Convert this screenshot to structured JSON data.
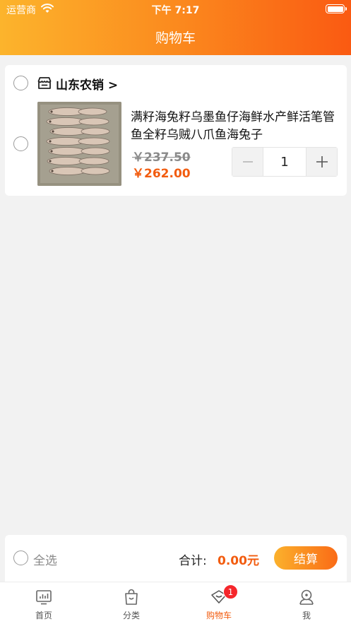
{
  "status_bar": {
    "carrier": "运营商",
    "time": "下午 7:17"
  },
  "nav": {
    "title": "购物车"
  },
  "store": {
    "name": "山东农销 >"
  },
  "item": {
    "title": "满籽海兔籽乌墨鱼仔海鲜水产鲜活笔管鱼全籽乌贼八爪鱼海兔子",
    "original_price": "￥237.50",
    "price": "￥262.00",
    "quantity": "1"
  },
  "checkout": {
    "select_all_label": "全选",
    "total_label": "合计:",
    "total_value": "0.00元",
    "button_label": "结算"
  },
  "tabbar": {
    "tabs": [
      {
        "label": "首页",
        "icon": "home-chart-icon"
      },
      {
        "label": "分类",
        "icon": "bag-icon"
      },
      {
        "label": "购物车",
        "icon": "cart-icon",
        "badge": "1"
      },
      {
        "label": "我",
        "icon": "profile-icon"
      }
    ]
  },
  "colors": {
    "accent": "#f25c0f",
    "header_start": "#fcb42c",
    "header_end": "#fa5a12",
    "badge": "#f5262b"
  }
}
